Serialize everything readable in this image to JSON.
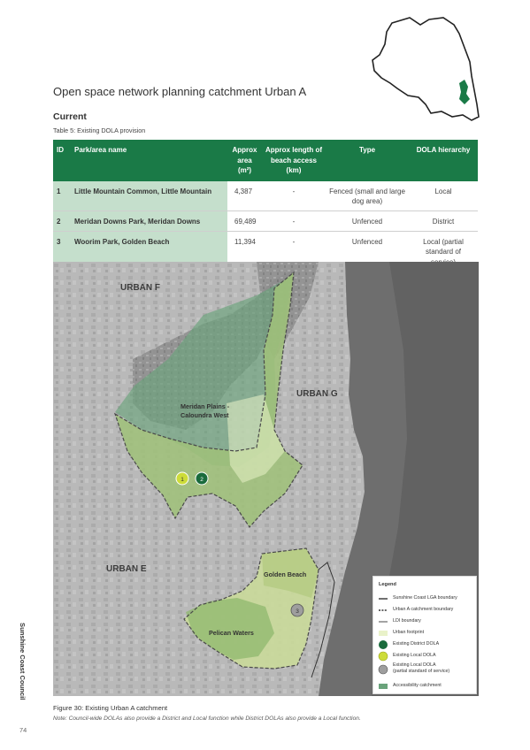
{
  "header": {
    "title": "Open space network planning catchment Urban A",
    "section": "Current",
    "table_caption": "Table 5: Existing DOLA provision"
  },
  "table": {
    "columns": [
      "ID",
      "Park/area name",
      "Approx area (m²)",
      "Approx length of beach access (km)",
      "Type",
      "DOLA hierarchy"
    ],
    "rows": [
      {
        "id": "1",
        "name": "Little Mountain Common, Little Mountain",
        "area": "4,387",
        "beach": "-",
        "type": "Fenced (small and large dog area)",
        "hierarchy": "Local"
      },
      {
        "id": "2",
        "name": "Meridan Downs Park, Meridan Downs",
        "area": "69,489",
        "beach": "-",
        "type": "Unfenced",
        "hierarchy": "District"
      },
      {
        "id": "3",
        "name": "Woorim Park, Golden Beach",
        "area": "11,394",
        "beach": "-",
        "type": "Unfenced",
        "hierarchy": "Local (partial standard of service)"
      }
    ]
  },
  "map": {
    "region_labels": {
      "urban_f": "URBAN F",
      "urban_g": "URBAN G",
      "urban_e": "URBAN E",
      "meridan_line1": "Meridan Plains -",
      "meridan_line2": "Caloundra West",
      "golden_beach": "Golden Beach",
      "pelican_waters": "Pelican Waters"
    },
    "markers": [
      {
        "label": "1",
        "kind": "Existing Local DOLA"
      },
      {
        "label": "2",
        "kind": "Existing District DOLA"
      },
      {
        "label": "3",
        "kind": "Existing Local DOLA (partial standard of service)"
      }
    ],
    "colors": {
      "district": "#1a6b3c",
      "local": "#cddc39",
      "partial": "#9e9e9e",
      "catchment": "#6aa37b",
      "footprint": "#e9f2c9",
      "accent": "#1a7a47"
    }
  },
  "legend": {
    "title": "Legend",
    "items": [
      {
        "label": "Sunshine Coast LGA boundary",
        "icon": "lga-boundary-line"
      },
      {
        "label": "Urban A catchment boundary",
        "icon": "catchment-boundary-dashed-line"
      },
      {
        "label": "LDI boundary",
        "icon": "ldi-boundary-line"
      },
      {
        "label": "Urban footprint",
        "icon": "urban-footprint-swatch"
      },
      {
        "label": "Existing District DOLA",
        "icon": "district-dola-circle"
      },
      {
        "label": "Existing Local DOLA",
        "icon": "local-dola-circle"
      },
      {
        "label": "Existing Local DOLA",
        "label2": "(partial standard of service)",
        "icon": "partial-dola-circle"
      },
      {
        "label": "Accessibility catchment",
        "icon": "accessibility-catchment-swatch"
      }
    ]
  },
  "figure": {
    "caption": "Figure 30: Existing Urban A catchment",
    "note": "Note: Council-wide DOLAs also provide a District and Local function while District DOLAs also provide a Local function."
  },
  "footer": {
    "side_label": "Sunshine Coast Council",
    "page_number": "74"
  }
}
